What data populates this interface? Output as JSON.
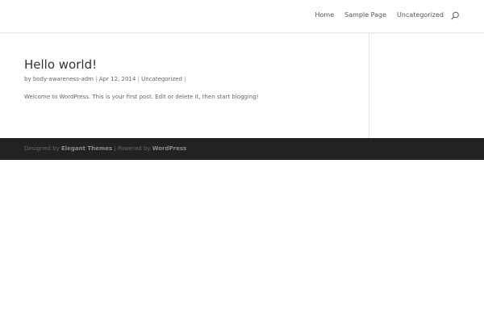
{
  "nav": {
    "items": [
      {
        "label": "Home"
      },
      {
        "label": "Sample Page"
      },
      {
        "label": "Uncategorized"
      }
    ],
    "search_icon": "search-icon"
  },
  "post": {
    "title": "Hello world!",
    "meta": {
      "by": "by",
      "author": "body-awareness-adm",
      "separator": "|",
      "date": "Apr 12, 2014",
      "category": "Uncategorized"
    },
    "body": "Welcome to WordPress. This is your first post. Edit or delete it, then start blogging!"
  },
  "footer": {
    "designed_by": "Designed by",
    "designer": "Elegant Themes",
    "powered_by": "| Powered by",
    "platform": "WordPress"
  },
  "colors": {
    "footer_bg": "#222222",
    "text": "#666666",
    "title": "#333333"
  }
}
